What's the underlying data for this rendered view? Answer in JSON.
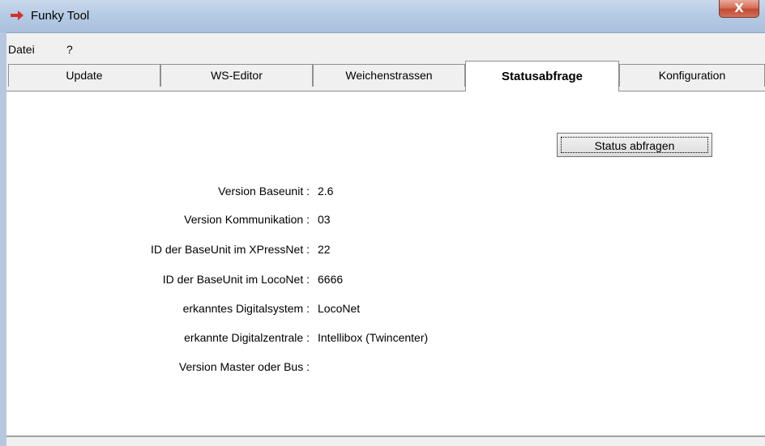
{
  "window": {
    "title": "Funky Tool",
    "close_label": "X"
  },
  "menu": {
    "items": [
      "Datei",
      "?"
    ]
  },
  "tabs": [
    "Update",
    "WS-Editor",
    "Weichenstrassen",
    "Statusabfrage",
    "Konfiguration"
  ],
  "active_tab": "Statusabfrage",
  "status": {
    "button_label": "Status abfragen",
    "rows": [
      {
        "label": "Version Baseunit :",
        "value": "2.6"
      },
      {
        "label": "Version Kommunikation :",
        "value": "03"
      },
      {
        "label": "ID der BaseUnit im XPressNet :",
        "value": "22"
      },
      {
        "label": "ID der BaseUnit im LocoNet :",
        "value": "6666"
      },
      {
        "label": "erkanntes Digitalsystem :",
        "value": "LocoNet"
      },
      {
        "label": "erkannte Digitalzentrale :",
        "value": "Intellibox (Twincenter)"
      },
      {
        "label": "Version Master oder Bus :",
        "value": ""
      }
    ]
  },
  "colors": {
    "accent_arrow": "#c0392b",
    "close": "#c24a31"
  }
}
